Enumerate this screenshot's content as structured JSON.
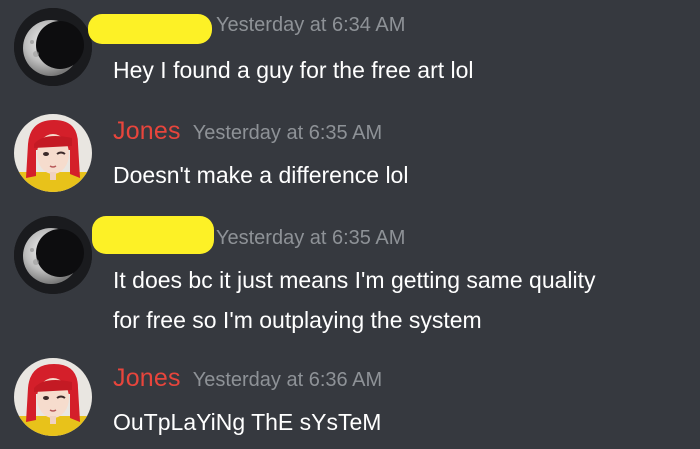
{
  "messages": [
    {
      "author": "",
      "author_redacted": true,
      "avatar_icon": "crescent-moon-avatar",
      "timestamp": "Yesterday at 6:34 AM",
      "lines": [
        "Hey I found a guy for the free art lol"
      ]
    },
    {
      "author": "Jones",
      "author_color": "#e8453c",
      "avatar_icon": "red-hair-girl-avatar",
      "timestamp": "Yesterday at 6:35 AM",
      "lines": [
        "Doesn't make a difference lol"
      ]
    },
    {
      "author": "",
      "author_redacted": true,
      "avatar_icon": "crescent-moon-avatar",
      "timestamp": "Yesterday at 6:35 AM",
      "lines": [
        "It does bc it just means I'm getting same quality",
        "for free so I'm outplaying the system"
      ]
    },
    {
      "author": "Jones",
      "author_color": "#e8453c",
      "avatar_icon": "red-hair-girl-avatar",
      "timestamp": "Yesterday at 6:36 AM",
      "lines": [
        "OuTpLaYiNg ThE sYsTeM"
      ]
    }
  ],
  "colors": {
    "background": "#36393f",
    "timestamp": "#8e9297",
    "redaction": "#fdf126"
  }
}
